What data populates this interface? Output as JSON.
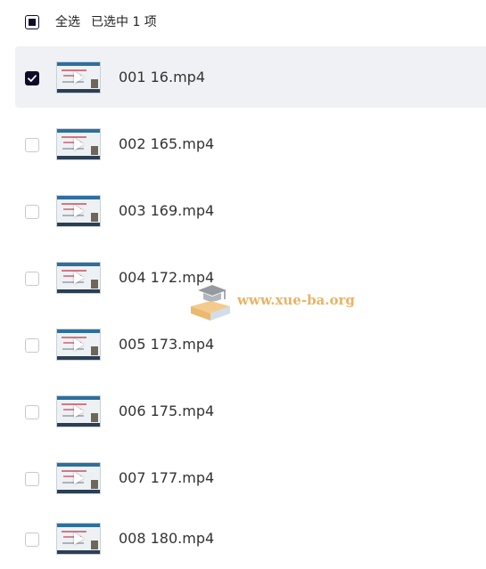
{
  "header": {
    "select_all_label": "全选",
    "selected_count_text": "已选中 1 项",
    "select_all_state": "partial"
  },
  "files": [
    {
      "name": "001 16.mp4",
      "checked": true
    },
    {
      "name": "002 165.mp4",
      "checked": false
    },
    {
      "name": "003 169.mp4",
      "checked": false
    },
    {
      "name": "004 172.mp4",
      "checked": false
    },
    {
      "name": "005 173.mp4",
      "checked": false
    },
    {
      "name": "006 175.mp4",
      "checked": false
    },
    {
      "name": "007 177.mp4",
      "checked": false
    },
    {
      "name": "008 180.mp4",
      "checked": false
    }
  ],
  "watermark": {
    "text": "www.xue-ba.org"
  },
  "colors": {
    "accent": "#0d0d2b",
    "selected_row_bg": "#f0f1f4",
    "watermark": "#e6a64a"
  },
  "icons": {
    "thumbnail_overlay": "play-icon",
    "checkbox_checked": "checkmark-icon"
  }
}
